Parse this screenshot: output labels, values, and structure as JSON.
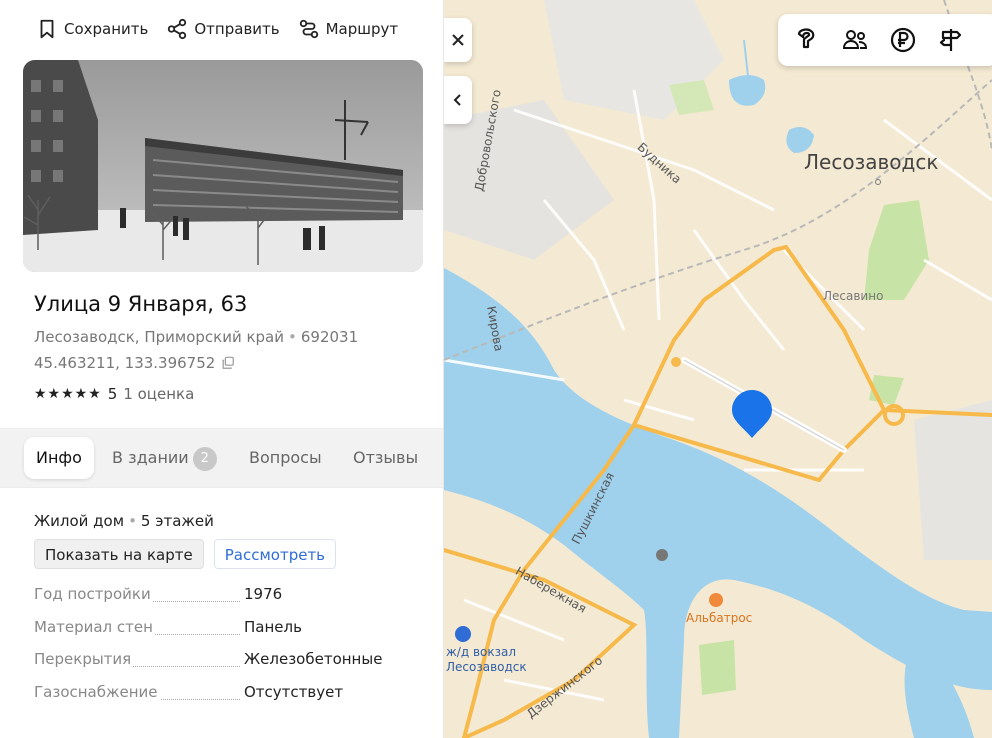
{
  "actions": {
    "save": "Сохранить",
    "share": "Отправить",
    "route": "Маршрут"
  },
  "place": {
    "title": "Улица 9 Января, 63",
    "address": "Лесозаводск, Приморский край",
    "postcode": "692031",
    "coordinates": "45.463211, 133.396752",
    "stars": "★★★★★",
    "rating_value": "5",
    "rating_count": "1 оценка"
  },
  "tabs": [
    {
      "label": "Инфо",
      "active": true
    },
    {
      "label": "В здании",
      "badge": "2"
    },
    {
      "label": "Вопросы"
    },
    {
      "label": "Отзывы"
    }
  ],
  "info": {
    "building_type": "Жилой дом",
    "floors": "5 этажей",
    "show_on_map": "Показать на карте",
    "view": "Рассмотреть",
    "properties": [
      {
        "key": "Год постройки",
        "value": "1976"
      },
      {
        "key": "Материал стен",
        "value": "Панель"
      },
      {
        "key": "Перекрытия",
        "value": "Железобетонные"
      },
      {
        "key": "Газоснабжение",
        "value": "Отсутствует"
      }
    ]
  },
  "map": {
    "city_label": "Лесозаводск",
    "streets": {
      "dobrovolskogo": "Добровольского",
      "budnika": "Будника",
      "kirova": "Кирова",
      "pushkinskaya": "Пушкинская",
      "naberezhnaya": "Набережная",
      "dzerzhinskogo": "Дзержинского"
    },
    "places": {
      "lesavino": "Лесавино",
      "albatros": "Альбатрос",
      "station_line1": "ж/д вокзал",
      "station_line2": "Лесозаводск"
    },
    "colors": {
      "land": "#f4ead3",
      "water": "#9fd0ec",
      "park": "#c8e3a6",
      "road_major": "#f6b94a",
      "marker": "#1a73e8"
    }
  }
}
